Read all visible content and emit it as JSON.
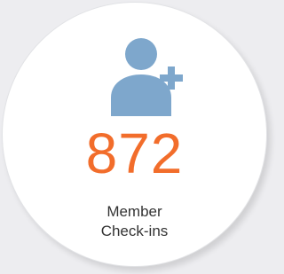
{
  "card": {
    "icon": "add-user-icon",
    "value": "872",
    "label_line_1": "Member",
    "label_line_2": "Check-ins"
  },
  "colors": {
    "background": "#ededf0",
    "card": "#ffffff",
    "icon": "#7ea7cc",
    "value": "#f26d2b",
    "label": "#333333"
  }
}
